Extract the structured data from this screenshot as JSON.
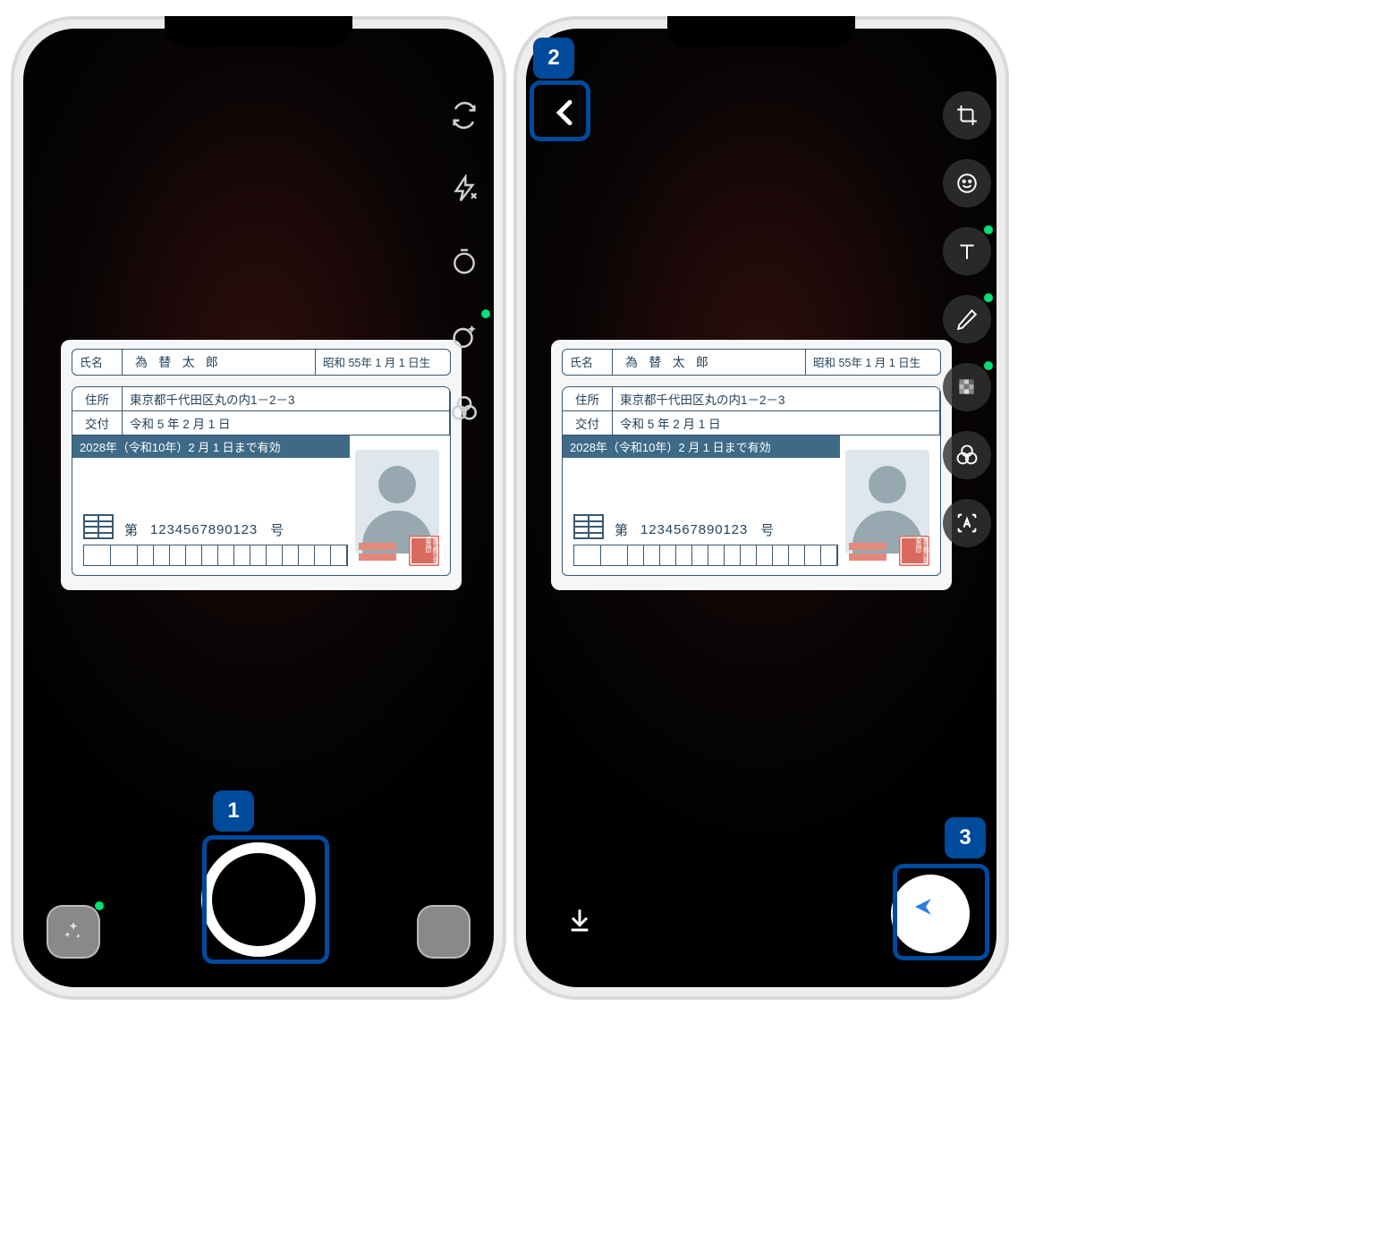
{
  "callouts": {
    "c1": "1",
    "c2": "2",
    "c3": "3"
  },
  "card": {
    "name_label": "氏名",
    "name_value": "為  替  太  郎",
    "dob": "昭和 55年 1 月 1 日生",
    "address_label": "住所",
    "address_value": "東京都千代田区丸の内1－2－3",
    "issue_label": "交付",
    "issue_value": "令和 5 年 2 月 1 日",
    "valid_until": "2028年（令和10年）2 月 1 日まで有効",
    "num_dai": "第",
    "num_value": "1234567890123",
    "num_go": "号"
  },
  "seal_text": "東京都公安委員印"
}
